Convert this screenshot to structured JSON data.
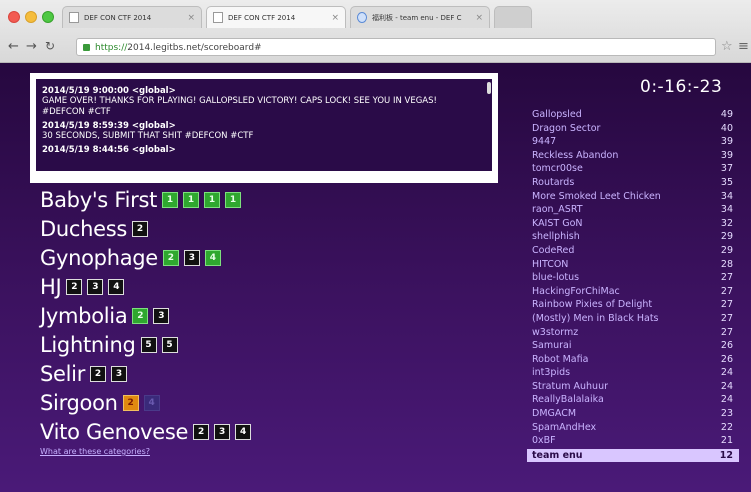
{
  "browser": {
    "tabs": [
      {
        "label": "DEF CON CTF 2014",
        "active": false,
        "icon": "page-icon"
      },
      {
        "label": "DEF CON CTF 2014",
        "active": true,
        "icon": "page-icon"
      },
      {
        "label": "福利板 - team enu - DEF C",
        "active": false,
        "icon": "search-icon"
      }
    ],
    "url_scheme": "https://",
    "url_rest": "2014.legitbs.net/scoreboard#"
  },
  "feed": {
    "messages": [
      {
        "head": "2014/5/19 9:00:00 <global>",
        "body": "GAME OVER! THANKS FOR PLAYING! GALLOPSLED VICTORY! CAPS LOCK! SEE YOU IN VEGAS! #DEFCON #CTF"
      },
      {
        "head": "2014/5/19 8:59:39 <global>",
        "body": "30 SECONDS, SUBMIT THAT SHIT #DEFCON #CTF"
      },
      {
        "head": "2014/5/19 8:44:56 <global>",
        "body": ""
      }
    ]
  },
  "categories": [
    {
      "name": "Baby's First",
      "boxes": [
        {
          "n": "1",
          "c": "green"
        },
        {
          "n": "1",
          "c": "green"
        },
        {
          "n": "1",
          "c": "green"
        },
        {
          "n": "1",
          "c": "green"
        }
      ]
    },
    {
      "name": "Duchess",
      "boxes": [
        {
          "n": "2",
          "c": "dark"
        }
      ]
    },
    {
      "name": "Gynophage",
      "boxes": [
        {
          "n": "2",
          "c": "green"
        },
        {
          "n": "3",
          "c": "dark"
        },
        {
          "n": "4",
          "c": "green"
        }
      ]
    },
    {
      "name": "HJ",
      "boxes": [
        {
          "n": "2",
          "c": "dark"
        },
        {
          "n": "3",
          "c": "dark"
        },
        {
          "n": "4",
          "c": "dark"
        }
      ]
    },
    {
      "name": "Jymbolia",
      "boxes": [
        {
          "n": "2",
          "c": "green"
        },
        {
          "n": "3",
          "c": "dark"
        }
      ]
    },
    {
      "name": "Lightning",
      "boxes": [
        {
          "n": "5",
          "c": "dark"
        },
        {
          "n": "5",
          "c": "dark"
        }
      ]
    },
    {
      "name": "Selir",
      "boxes": [
        {
          "n": "2",
          "c": "dark"
        },
        {
          "n": "3",
          "c": "dark"
        }
      ]
    },
    {
      "name": "Sirgoon",
      "boxes": [
        {
          "n": "2",
          "c": "orange"
        },
        {
          "n": "4",
          "c": "dim"
        }
      ]
    },
    {
      "name": "Vito Genovese",
      "boxes": [
        {
          "n": "2",
          "c": "dark"
        },
        {
          "n": "3",
          "c": "dark"
        },
        {
          "n": "4",
          "c": "dark"
        }
      ]
    }
  ],
  "what_link": "What are these categories?",
  "timer": "0:-16:-23",
  "scoreboard": [
    {
      "team": "Gallopsled",
      "score": "49"
    },
    {
      "team": "Dragon Sector",
      "score": "40"
    },
    {
      "team": "9447",
      "score": "39"
    },
    {
      "team": "Reckless Abandon",
      "score": "39"
    },
    {
      "team": "tomcr00se",
      "score": "37"
    },
    {
      "team": "Routards",
      "score": "35"
    },
    {
      "team": "More Smoked Leet Chicken",
      "score": "34"
    },
    {
      "team": "raon_ASRT",
      "score": "34"
    },
    {
      "team": "KAIST GoN",
      "score": "32"
    },
    {
      "team": "shellphish",
      "score": "29"
    },
    {
      "team": "CodeRed",
      "score": "29"
    },
    {
      "team": "HITCON",
      "score": "28"
    },
    {
      "team": "blue-lotus",
      "score": "27"
    },
    {
      "team": "HackingForChiMac",
      "score": "27"
    },
    {
      "team": "Rainbow Pixies of Delight",
      "score": "27"
    },
    {
      "team": "(Mostly) Men in Black Hats",
      "score": "27"
    },
    {
      "team": "w3stormz",
      "score": "27"
    },
    {
      "team": "Samurai",
      "score": "26"
    },
    {
      "team": "Robot Mafia",
      "score": "26"
    },
    {
      "team": "int3pids",
      "score": "24"
    },
    {
      "team": "Stratum Auhuur",
      "score": "24"
    },
    {
      "team": "ReallyBalalaika",
      "score": "24"
    },
    {
      "team": "DMGACM",
      "score": "23"
    },
    {
      "team": "SpamAndHex",
      "score": "22"
    },
    {
      "team": "0xBF",
      "score": "21"
    },
    {
      "team": "team enu",
      "score": "12",
      "highlight": true
    }
  ]
}
